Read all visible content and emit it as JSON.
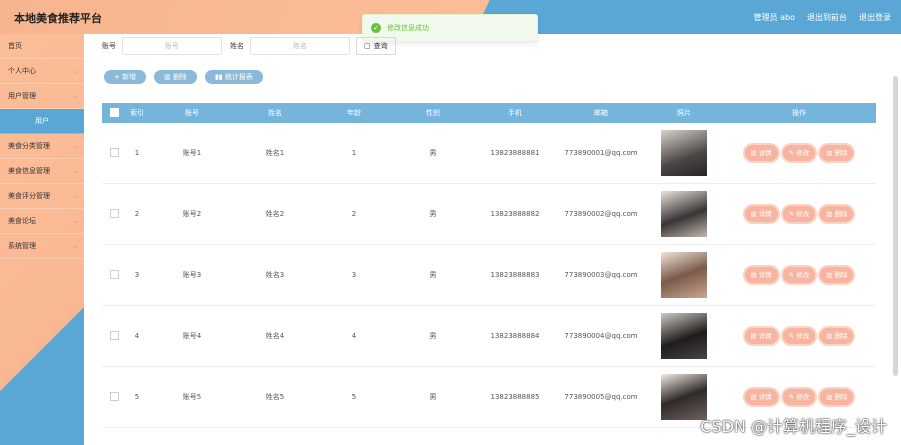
{
  "header": {
    "title": "本地美食推荐平台",
    "admin": "管理员 abo",
    "back": "退出到前台",
    "logout": "退出登录"
  },
  "toast": {
    "message": "修改信息成功"
  },
  "sidebar": {
    "items": [
      {
        "label": "首页",
        "chev": ""
      },
      {
        "label": "个人中心",
        "chev": "⌄"
      },
      {
        "label": "用户管理",
        "chev": "⌄"
      },
      {
        "label": "用户",
        "chev": ""
      },
      {
        "label": "美食分类管理",
        "chev": "⌄"
      },
      {
        "label": "美食信息管理",
        "chev": "⌄"
      },
      {
        "label": "美食评分管理",
        "chev": "⌄"
      },
      {
        "label": "美食论坛",
        "chev": "⌄"
      },
      {
        "label": "系统管理",
        "chev": "⌄"
      }
    ]
  },
  "search": {
    "label1": "账号",
    "placeholder1": "账号",
    "label2": "姓名",
    "placeholder2": "姓名",
    "btn": "查询"
  },
  "actions": {
    "add": "新增",
    "del": "删除",
    "stats": "统计报表"
  },
  "table": {
    "headers": [
      "索引",
      "账号",
      "姓名",
      "年龄",
      "性别",
      "手机",
      "邮箱",
      "照片",
      "操作"
    ],
    "rows": [
      {
        "idx": "1",
        "acct": "账号1",
        "name": "姓名1",
        "age": "1",
        "sex": "男",
        "phone": "13823888881",
        "email": "773890001@qq.com"
      },
      {
        "idx": "2",
        "acct": "账号2",
        "name": "姓名2",
        "age": "2",
        "sex": "男",
        "phone": "13823888882",
        "email": "773890002@qq.com"
      },
      {
        "idx": "3",
        "acct": "账号3",
        "name": "姓名3",
        "age": "3",
        "sex": "男",
        "phone": "13823888883",
        "email": "773890003@qq.com"
      },
      {
        "idx": "4",
        "acct": "账号4",
        "name": "姓名4",
        "age": "4",
        "sex": "男",
        "phone": "13823888884",
        "email": "773890004@qq.com"
      },
      {
        "idx": "5",
        "acct": "账号5",
        "name": "姓名5",
        "age": "5",
        "sex": "男",
        "phone": "13823888885",
        "email": "773890005@qq.com"
      }
    ],
    "ops": {
      "detail": "详情",
      "edit": "修改",
      "delete": "删除"
    }
  },
  "watermark": "CSDN @计算机程序_设计"
}
